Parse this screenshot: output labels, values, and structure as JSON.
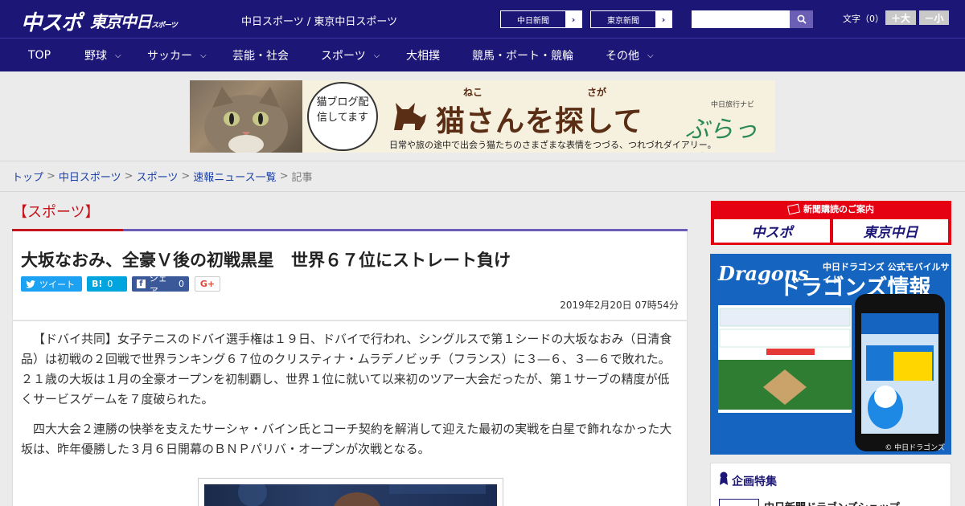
{
  "header": {
    "logo_chuspo": "中スポ",
    "logo_tokyo": "東京中日",
    "logo_tokyo_small": "スポーツ",
    "site_title": "中日スポーツ / 東京中日スポーツ",
    "links": [
      {
        "label": "中日新聞"
      },
      {
        "label": "東京新聞"
      }
    ],
    "search": {
      "placeholder": "",
      "icon": "search-icon"
    },
    "fontsize_label": "文字（0）",
    "fontsize_bigger": "＋大",
    "fontsize_smaller": "－小"
  },
  "nav": {
    "items": [
      {
        "label": "TOP",
        "has_dropdown": false
      },
      {
        "label": "野球",
        "has_dropdown": true
      },
      {
        "label": "サッカー",
        "has_dropdown": true
      },
      {
        "label": "芸能・社会",
        "has_dropdown": false
      },
      {
        "label": "スポーツ",
        "has_dropdown": true
      },
      {
        "label": "大相撲",
        "has_dropdown": false
      },
      {
        "label": "競馬・ボート・競輪",
        "has_dropdown": false
      },
      {
        "label": "その他",
        "has_dropdown": true
      }
    ],
    "chevron": "⌵"
  },
  "banner": {
    "bubble": "猫ブログ配信してます",
    "ruby_neko": "ねこ",
    "ruby_saga": "さが",
    "headline": "猫さんを探して",
    "brand_small": "中日旅行ナビ",
    "brand": "ぶらっ人",
    "subtext": "日常や旅の途中で出会う猫たちのさまざまな表情をつづる、つれづれダイアリー。"
  },
  "breadcrumb": {
    "items": [
      "トップ",
      "中日スポーツ",
      "スポーツ",
      "速報ニュース一覧"
    ],
    "current": "記事",
    "separator": ">"
  },
  "article": {
    "section": "【スポーツ】",
    "headline": "大坂なおみ、全豪Ｖ後の初戦黒星　世界６７位にストレート負け",
    "share": {
      "tweet": "ツイート",
      "hatena": "B!",
      "hatena_count": "0",
      "facebook": "シェア",
      "facebook_count": "0",
      "gplus": "G+"
    },
    "date": "2019年2月20日 07時54分",
    "paragraphs": [
      "【ドバイ共同】女子テニスのドバイ選手権は１９日、ドバイで行われ、シングルスで第１シードの大坂なおみ（日清食品）は初戦の２回戦で世界ランキング６７位のクリスティナ・ムラデノビッチ（フランス）に３―６、３―６で敗れた。２１歳の大坂は１月の全豪オープンを初制覇し、世界１位に就いて以来初のツアー大会だったが、第１サーブの精度が低くサービスゲームを７度破られた。",
      "四大大会２連勝の快挙を支えたサーシャ・バイン氏とコーチ契約を解消して迎えた最初の実戦を白星で飾れなかった大坂は、昨年優勝した３月６日開幕のＢＮＰパリバ・オープンが次戦となる。"
    ]
  },
  "sidebar": {
    "subscription": {
      "title": "新聞購読のご案内",
      "btn1": "中スポ",
      "btn2": "東京中日"
    },
    "dragons_ad": {
      "logo": "Dragons",
      "subtitle": "中日ドラゴンズ 公式モバイルサイト",
      "title": "ドラゴンズ情報",
      "copyright": "© 中日ドラゴンズ"
    },
    "feature": {
      "title": "企画特集",
      "item": "中日新聞ドラゴンズショップ"
    }
  },
  "colors": {
    "header_bg": "#1c1677",
    "accent_red": "#c4161c",
    "accent_purple": "#6b5fb5",
    "link": "#1a3fa5"
  }
}
